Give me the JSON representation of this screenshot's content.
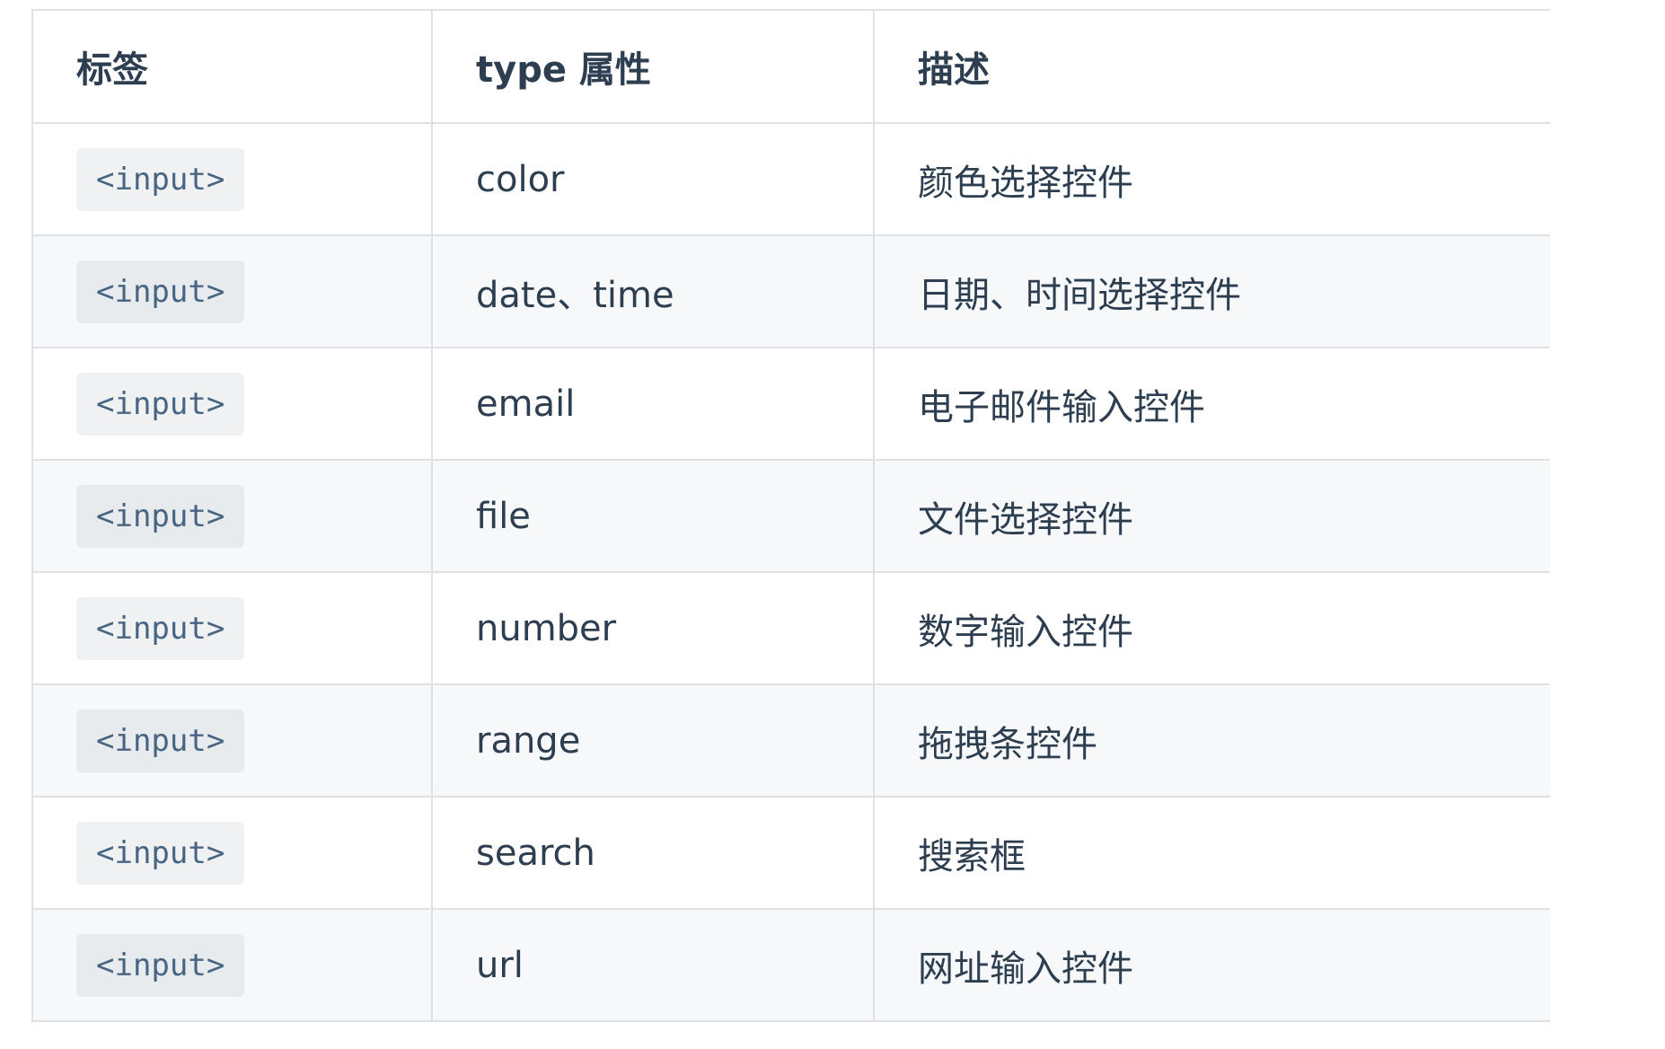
{
  "table": {
    "headers": [
      "标签",
      "type 属性",
      "描述"
    ],
    "rows": [
      {
        "tag": "<input>",
        "type": "color",
        "desc": "颜色选择控件"
      },
      {
        "tag": "<input>",
        "type": "date、time",
        "desc": "日期、时间选择控件"
      },
      {
        "tag": "<input>",
        "type": "email",
        "desc": "电子邮件输入控件"
      },
      {
        "tag": "<input>",
        "type": "file",
        "desc": "文件选择控件"
      },
      {
        "tag": "<input>",
        "type": "number",
        "desc": "数字输入控件"
      },
      {
        "tag": "<input>",
        "type": "range",
        "desc": "拖拽条控件"
      },
      {
        "tag": "<input>",
        "type": "search",
        "desc": "搜索框"
      },
      {
        "tag": "<input>",
        "type": "url",
        "desc": "网址输入控件"
      }
    ]
  },
  "colors": {
    "text": "#2c3e50",
    "border": "#dfe2e5",
    "stripe": "#f6f8fa",
    "code_bg": "#eff1f3",
    "code_text": "#476582"
  }
}
